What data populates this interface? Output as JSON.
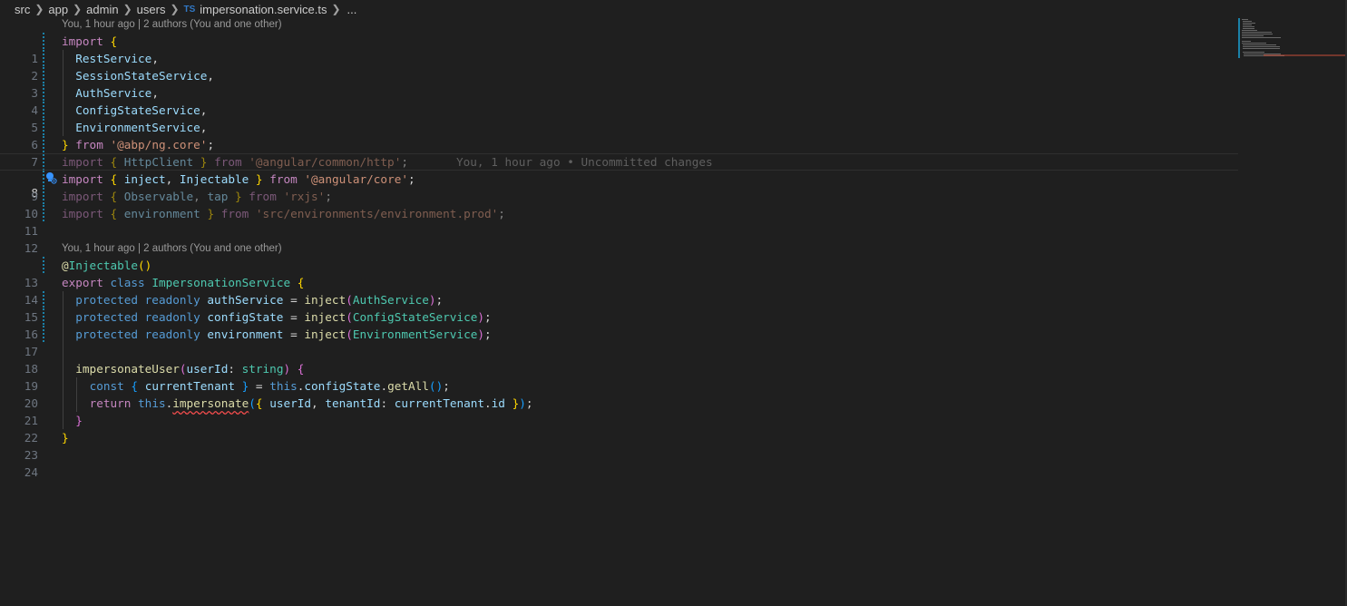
{
  "breadcrumb": {
    "segments": [
      "src",
      "app",
      "admin",
      "users"
    ],
    "file_badge": "TS",
    "file_name": "impersonation.service.ts",
    "ellipsis": "..."
  },
  "codelens": {
    "first": "You, 1 hour ago | 2 authors (You and one other)",
    "second": "You, 1 hour ago | 2 authors (You and one other)"
  },
  "editor": {
    "line_numbers": [
      "1",
      "2",
      "3",
      "4",
      "5",
      "6",
      "7",
      "8",
      "9",
      "10",
      "11",
      "12",
      "13",
      "14",
      "15",
      "16",
      "17",
      "18",
      "19",
      "20",
      "21",
      "22",
      "23",
      "24"
    ],
    "current_line": "8",
    "inline_blame": "You, 1 hour ago • Uncommitted changes",
    "tokens": {
      "l1": [
        "import",
        "{"
      ],
      "l2": [
        "RestService",
        ","
      ],
      "l3": [
        "SessionStateService",
        ","
      ],
      "l4": [
        "AuthService",
        ","
      ],
      "l5": [
        "ConfigStateService",
        ","
      ],
      "l6": [
        "EnvironmentService",
        ","
      ],
      "l7": [
        "}",
        "from",
        "'@abp/ng.core'",
        ";"
      ],
      "l8": [
        "import",
        "{",
        "HttpClient",
        "}",
        "from",
        "'@angular/common/http'",
        ";"
      ],
      "l9": [
        "import",
        "{",
        "inject",
        ",",
        "Injectable",
        "}",
        "from",
        "'@angular/core'",
        ";"
      ],
      "l10": [
        "import",
        "{",
        "Observable",
        ",",
        "tap",
        "}",
        "from",
        "'rxjs'",
        ";"
      ],
      "l11": [
        "import",
        "{",
        "environment",
        "}",
        "from",
        "'src/environments/environment.prod'",
        ";"
      ],
      "l13": [
        "@",
        "Injectable",
        "(",
        ")"
      ],
      "l14": [
        "export",
        "class",
        "ImpersonationService",
        "{"
      ],
      "l15": [
        "protected",
        "readonly",
        "authService",
        "=",
        "inject",
        "(",
        "AuthService",
        ")",
        ";"
      ],
      "l16": [
        "protected",
        "readonly",
        "configState",
        "=",
        "inject",
        "(",
        "ConfigStateService",
        ")",
        ";"
      ],
      "l17": [
        "protected",
        "readonly",
        "environment",
        "=",
        "inject",
        "(",
        "EnvironmentService",
        ")",
        ";"
      ],
      "l19": [
        "impersonateUser",
        "(",
        "userId",
        ":",
        "string",
        ")",
        "{"
      ],
      "l20": [
        "const",
        "{",
        "currentTenant",
        "}",
        "=",
        "this",
        ".",
        "configState",
        ".",
        "getAll",
        "(",
        ")",
        ";"
      ],
      "l21": [
        "return",
        "this",
        ".",
        "impersonate",
        "(",
        "{",
        "userId",
        ",",
        "tenantId",
        ":",
        "currentTenant",
        ".",
        "id",
        "}",
        ")",
        ";"
      ],
      "l22": [
        "}"
      ],
      "l23": [
        "}"
      ]
    }
  },
  "colors": {
    "background": "#1f1f1f",
    "keyword_control": "#c586c0",
    "keyword": "#569cd6",
    "variable": "#9cdcfe",
    "type": "#4ec9b0",
    "string": "#ce9178",
    "function": "#dcdcaa",
    "bracket_1": "#ffd700",
    "bracket_2": "#da70d6",
    "bracket_3": "#179fff",
    "change_bar": "#1b81a8",
    "error": "#f14c4c"
  },
  "icons": {
    "lightbulb": "lightbulb-autofix-icon",
    "chevron": "chevron-right-icon"
  }
}
